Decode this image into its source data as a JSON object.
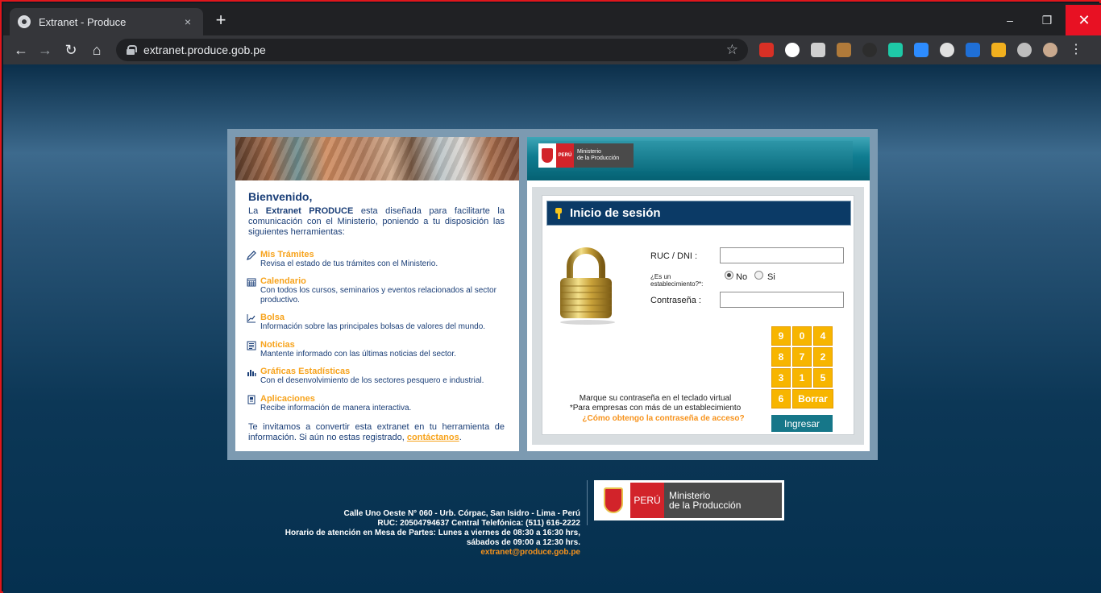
{
  "browser": {
    "tab_title": "Extranet - Produce",
    "tab_close": "×",
    "new_tab": "+",
    "url": "extranet.produce.gob.pe",
    "window_min": "–",
    "window_max": "❐",
    "window_close": "✕",
    "back": "←",
    "forward": "→",
    "reload": "↻",
    "home": "⌂",
    "bookmark_star": "☆",
    "extensions": [
      {
        "name": "adblock-icon",
        "color": "#d93025"
      },
      {
        "name": "ghost-icon",
        "color": "#ffffff"
      },
      {
        "name": "circle-icon",
        "color": "#cfcfcf"
      },
      {
        "name": "cookie-icon",
        "color": "#b07a3a"
      },
      {
        "name": "x-icon",
        "color": "#2d2d2d"
      },
      {
        "name": "teal-dot-icon",
        "color": "#1ec9a7"
      },
      {
        "name": "zoom-icon",
        "color": "#2d8cff"
      },
      {
        "name": "chat-icon",
        "color": "#e0e0e0"
      },
      {
        "name": "ui-icon",
        "color": "#1f6fd6"
      },
      {
        "name": "chart-icon",
        "color": "#f2b01e"
      },
      {
        "name": "b-icon",
        "color": "#bdbdbd"
      },
      {
        "name": "profile-avatar",
        "color": "#c9a98e"
      },
      {
        "name": "menu-icon",
        "color": "#e8eaed"
      }
    ]
  },
  "page": {
    "welcome": "Bienvenido,",
    "intro_prefix": "La ",
    "intro_brand": "Extranet PRODUCE",
    "intro_rest": " esta diseñada para facilitarte la comunicación con el Ministerio, poniendo a tu disposición las siguientes herramientas:",
    "tools": [
      {
        "title": "Mis Trámites",
        "desc": "Revisa el estado de tus trámites con el Ministerio.",
        "icon": "pencil-icon"
      },
      {
        "title": "Calendario",
        "desc": "Con todos los cursos, seminarios y eventos relacionados al sector productivo.",
        "icon": "calendar-icon"
      },
      {
        "title": "Bolsa",
        "desc": "Información sobre las principales bolsas de valores del mundo.",
        "icon": "trend-icon"
      },
      {
        "title": "Noticias",
        "desc": "Mantente informado con las últimas noticias del sector.",
        "icon": "newspaper-icon"
      },
      {
        "title": "Gráficas Estadísticas",
        "desc": "Con el desenvolvimiento de los sectores pesquero e industrial.",
        "icon": "bar-chart-icon"
      },
      {
        "title": "Aplicaciones",
        "desc": "Recibe información de manera interactiva.",
        "icon": "app-icon"
      }
    ],
    "invite_text": "Te invitamos a convertir esta extranet en tu herramienta de información. Si aún no estas registrado, ",
    "invite_link": "contáctanos",
    "invite_end": ".",
    "logo_small": {
      "peru": "PERÚ",
      "ministry_line1": "Ministerio",
      "ministry_line2": "de la Producción"
    }
  },
  "login": {
    "title": "Inicio de sesión",
    "ruc_label": "RUC / DNI :",
    "ruc_value": "",
    "establishment_label": "¿Es un establecimiento?*:",
    "radio_no": "No",
    "radio_si": "Si",
    "selected": "No",
    "password_label": "Contraseña :",
    "password_value": "",
    "keypad": [
      "9",
      "0",
      "4",
      "8",
      "7",
      "2",
      "3",
      "1",
      "5",
      "6"
    ],
    "clear_label": "Borrar",
    "note_1": "Marque su contraseña en el teclado virtual",
    "note_2": "*Para empresas con más de un establecimiento",
    "help_link": "¿Cómo obtengo la contraseña de acceso?",
    "submit": "Ingresar"
  },
  "footer": {
    "address": "Calle Uno Oeste N° 060 - Urb. Córpac, San Isidro - Lima - Perú",
    "ruc": "RUC: 20504794637 Central Telefónica: (511) 616-2222",
    "hours_1": "Horario de atención en Mesa de Partes: Lunes a viernes de 08:30 a 16:30 hrs,",
    "hours_2": "sábados de 09:00 a 12:30 hrs.",
    "email": "extranet@produce.gob.pe",
    "logo": {
      "peru": "PERÚ",
      "ministry_line1": "Ministerio",
      "ministry_line2": "de la Producción"
    }
  }
}
